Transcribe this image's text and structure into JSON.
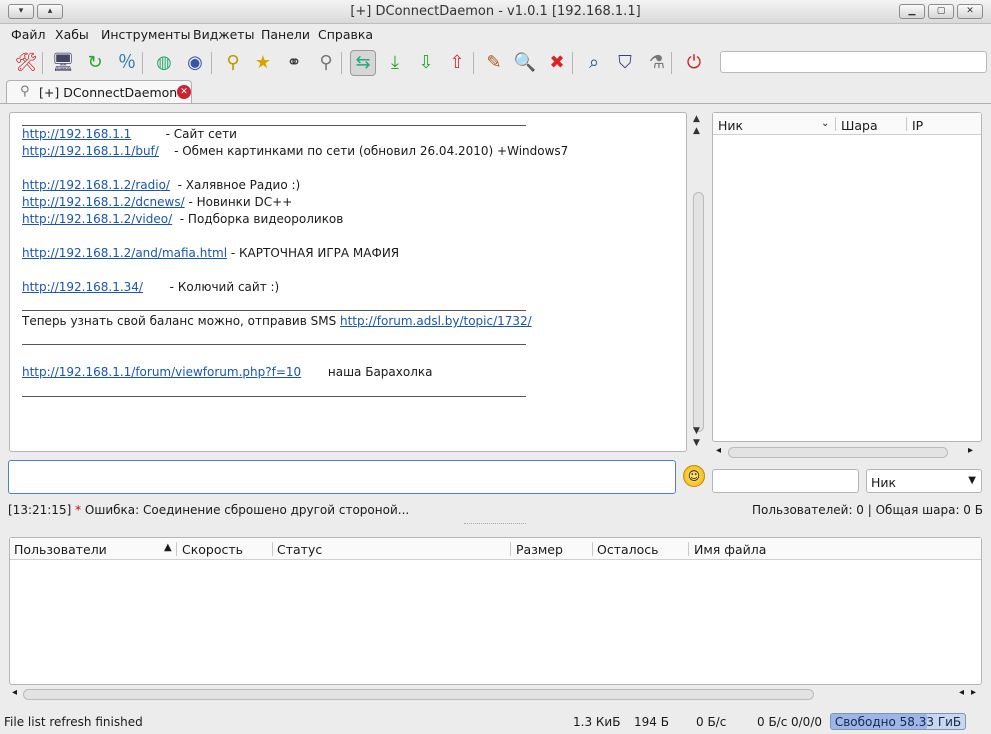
{
  "window": {
    "title": "[+] DConnectDaemon - v1.0.1 [192.168.1.1]"
  },
  "menu": [
    "Файл",
    "Хабы",
    "Инструменты",
    "Виджеты",
    "Панели",
    "Справка"
  ],
  "toolbar_icons": [
    {
      "name": "settings-tools-icon",
      "glyph": "🛠",
      "color": "#b22"
    },
    {
      "name": "hub-connect-icon",
      "glyph": "🖥",
      "color": "#446"
    },
    {
      "name": "reconnect-icon",
      "glyph": "↻",
      "color": "#2a2"
    },
    {
      "name": "speed-percent-icon",
      "glyph": "％",
      "color": "#27a"
    },
    {
      "name": "refresh-globe-icon",
      "glyph": "◍",
      "color": "#2a6"
    },
    {
      "name": "internet-globe-icon",
      "glyph": "◉",
      "color": "#35a"
    },
    {
      "name": "pin-icon",
      "glyph": "⚲",
      "color": "#b90"
    },
    {
      "name": "favorite-user-icon",
      "glyph": "★",
      "color": "#d9a400"
    },
    {
      "name": "binoculars-icon",
      "glyph": "⚭",
      "color": "#333"
    },
    {
      "name": "pin-gray-icon",
      "glyph": "⚲",
      "color": "#777"
    },
    {
      "name": "network-share-icon",
      "glyph": "⇆",
      "color": "#2a7"
    },
    {
      "name": "download-icon",
      "glyph": "⤓",
      "color": "#2a2"
    },
    {
      "name": "download-queue-icon",
      "glyph": "⇩",
      "color": "#2a2"
    },
    {
      "name": "upload-queue-icon",
      "glyph": "⇧",
      "color": "#c33"
    },
    {
      "name": "clear-broom-icon",
      "glyph": "✎",
      "color": "#a52"
    },
    {
      "name": "search-icon",
      "glyph": "🔍",
      "color": "#258"
    },
    {
      "name": "close-red-icon",
      "glyph": "✖",
      "color": "#d22"
    },
    {
      "name": "search-spy-icon",
      "glyph": "⌕",
      "color": "#258"
    },
    {
      "name": "shield-icon",
      "glyph": "⛉",
      "color": "#347"
    },
    {
      "name": "filter-icon",
      "glyph": "⚗",
      "color": "#777"
    },
    {
      "name": "power-icon",
      "glyph": "⏻",
      "color": "#c22"
    }
  ],
  "tab": {
    "label": "[+] DConnectDaemon"
  },
  "chat": [
    {
      "type": "hr"
    },
    {
      "type": "line",
      "link": "http://192.168.1.1",
      "text": "         - Сайт сети"
    },
    {
      "type": "line",
      "link": "http://192.168.1.1/buf/",
      "text": "    - Обмен картинками по сети (обновил 26.04.2010) +Windows7"
    },
    {
      "type": "line",
      "link": "http://192.168.1.2/radio/",
      "text": "  - Халявное Радио :)"
    },
    {
      "type": "line",
      "link": "http://192.168.1.2/dcnews/",
      "text": " - Новинки DC++"
    },
    {
      "type": "line",
      "link": "http://192.168.1.2/video/",
      "text": "  - Подборка видеороликов"
    },
    {
      "type": "line",
      "link": "http://192.168.1.2/and/mafia.html",
      "text": " - КАРТОЧНАЯ ИГРА МАФИЯ"
    },
    {
      "type": "line",
      "link": "http://192.168.1.34/",
      "text": "       - Колючий сайт :)"
    },
    {
      "type": "hr"
    },
    {
      "type": "line",
      "prefix": "Теперь узнать свой баланс можно, отправив SMS ",
      "link": "http://forum.adsl.by/topic/1732/",
      "text": ""
    },
    {
      "type": "hr"
    },
    {
      "type": "line",
      "link": "http://192.168.1.1/forum/viewforum.php?f=10",
      "text": "       наша Барахолка"
    },
    {
      "type": "hr"
    }
  ],
  "users_panel": {
    "columns": [
      "Ник",
      "Шара",
      "IP"
    ]
  },
  "nick_select": {
    "value": "Ник"
  },
  "status": {
    "time": "[13:21:15]",
    "star": "*",
    "message": "Ошибка: Соединение сброшено другой стороной...",
    "users": "Пользователей: 0 | Общая шара: 0 Б"
  },
  "transfers": {
    "columns": [
      "Пользователи",
      "Скорость",
      "Статус",
      "Размер",
      "Осталось",
      "Имя файла"
    ]
  },
  "statusbar": {
    "message": "File list refresh finished",
    "size1": "1.3 КиБ",
    "size2": "194 Б",
    "speed1": "0 Б/с",
    "speed2": "0 Б/с",
    "counts": "0/0/0",
    "free_label": "Свободно 58.33 ГиБ",
    "free_fraction": 0.72
  }
}
